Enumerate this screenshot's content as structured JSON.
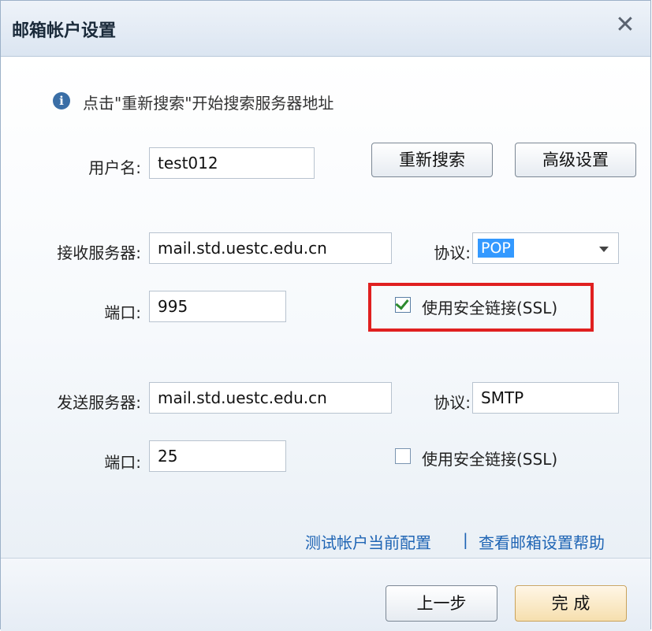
{
  "dialog": {
    "title": "邮箱帐户设置",
    "close_glyph": "✕"
  },
  "info": {
    "icon": "info-icon",
    "icon_glyph": "i",
    "text": "点击\"重新搜索\"开始搜索服务器地址"
  },
  "account": {
    "username_label": "用户名:",
    "username_value": "test012",
    "research_button": "重新搜索",
    "advanced_button": "高级设置"
  },
  "incoming": {
    "server_label": "接收服务器:",
    "server_value": "mail.std.uestc.edu.cn",
    "protocol_label": "协议:",
    "protocol_value": "POP",
    "port_label": "端口:",
    "port_value": "995",
    "ssl_label": "使用安全链接(SSL)",
    "ssl_checked": true
  },
  "outgoing": {
    "server_label": "发送服务器:",
    "server_value": "mail.std.uestc.edu.cn",
    "protocol_label": "协议:",
    "protocol_value": "SMTP",
    "port_label": "端口:",
    "port_value": "25",
    "ssl_label": "使用安全链接(SSL)",
    "ssl_checked": false
  },
  "links": {
    "test_config": "测试帐户当前配置",
    "separator": "|",
    "help": "查看邮箱设置帮助"
  },
  "footer": {
    "back_button": "上一步",
    "finish_button": "完 成"
  },
  "colors": {
    "highlight_border": "#e02020",
    "link": "#1e64b4",
    "selection": "#3399ff"
  }
}
